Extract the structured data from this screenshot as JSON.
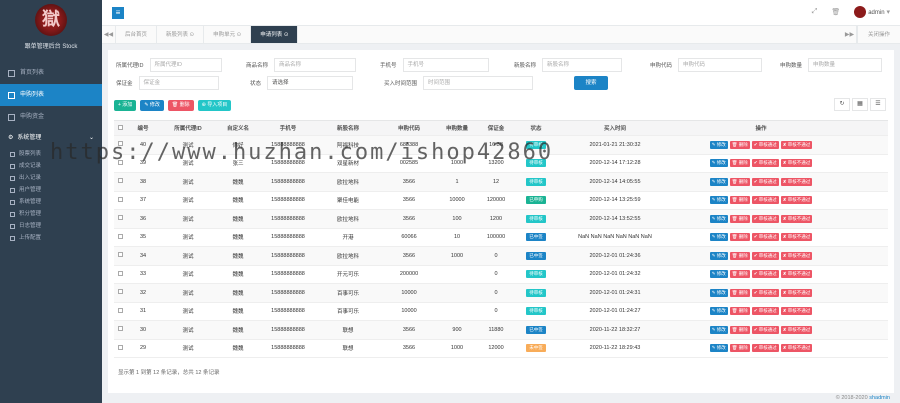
{
  "brand": {
    "title": "跟单管理后台 Stock",
    "badge": "獄"
  },
  "sidebar": {
    "items": [
      {
        "label": "首页列表"
      },
      {
        "label": "申购列表"
      },
      {
        "label": "申购资金"
      }
    ],
    "group": {
      "label": "系统管理",
      "caret": "⌄"
    },
    "sub": [
      {
        "label": "股票列表"
      },
      {
        "label": "成交记录"
      },
      {
        "label": "出入记录"
      },
      {
        "label": "用户管理"
      },
      {
        "label": "系统管理"
      },
      {
        "label": "积分管理"
      },
      {
        "label": "日志管理"
      },
      {
        "label": "上传配置"
      }
    ]
  },
  "topbar": {
    "menu_icon": "≡",
    "admin": "admin",
    "caret": "▾"
  },
  "tabs": {
    "prev": "◀◀",
    "items": [
      {
        "label": "后台首页"
      },
      {
        "label": "新股列表 ⊙"
      },
      {
        "label": "申购单元 ⊙"
      },
      {
        "label": "申请列表 ⊙"
      }
    ],
    "next": "▶▶",
    "close_ops": "关闭操作"
  },
  "filters": {
    "row1": [
      {
        "label": "所属代理ID",
        "placeholder": "所属代理ID"
      },
      {
        "label": "商品名称",
        "placeholder": "商品名称"
      },
      {
        "label": "手机号",
        "placeholder": "手机号"
      },
      {
        "label": "新股名称",
        "placeholder": "新股名称"
      },
      {
        "label": "申购代码",
        "placeholder": "申购代码"
      },
      {
        "label": "申购数量",
        "placeholder": "申购数量"
      }
    ],
    "row2": [
      {
        "label": "保证金",
        "placeholder": "保证金"
      },
      {
        "label": "状态",
        "placeholder": "请选择"
      },
      {
        "label": "买入时间范围",
        "placeholder": "时间范围"
      }
    ],
    "search": "搜索"
  },
  "toolbar": {
    "add": "+ 添加",
    "edit": "✎ 修改",
    "del": "🗑 删除",
    "export": "⊕ 导入项目"
  },
  "table": {
    "headers": [
      "",
      "编号",
      "所属代理ID",
      "自定义名",
      "手机号",
      "新股名称",
      "申购代码",
      "申购数量",
      "保证金",
      "状态",
      "买入时间",
      "操作"
    ],
    "rows": [
      [
        "",
        "40",
        "测试",
        "你好",
        "15888888888",
        "阿福科技",
        "688388",
        "",
        "16.38",
        "待审核",
        "2021-01-21 21:30:32"
      ],
      [
        "",
        "39",
        "测试",
        "张三",
        "15888888888",
        "双星新材",
        "002585",
        "1000",
        "13200",
        "待审核",
        "2020-12-14 17:12:28"
      ],
      [
        "",
        "38",
        "测试",
        "魏魏",
        "15888888888",
        "欧拉地科",
        "3566",
        "1",
        "12",
        "待审核",
        "2020-12-14 14:05:55"
      ],
      [
        "",
        "37",
        "测试",
        "魏魏",
        "15888888888",
        "聚佳电能",
        "3566",
        "10000",
        "120000",
        "已申购",
        "2020-12-14 13:25:59"
      ],
      [
        "",
        "36",
        "测试",
        "魏魏",
        "15888888888",
        "欧拉地科",
        "3566",
        "100",
        "1200",
        "待审核",
        "2020-12-14 13:52:55"
      ],
      [
        "",
        "35",
        "测试",
        "魏魏",
        "15888888888",
        "开港",
        "60066",
        "10",
        "100000",
        "已中签",
        "NaN NaN NaN NaN NaN NaN"
      ],
      [
        "",
        "34",
        "测试",
        "魏魏",
        "15888888888",
        "欧拉地科",
        "3566",
        "1000",
        "0",
        "已中签",
        "2020-12-01 01:24:36"
      ],
      [
        "",
        "33",
        "测试",
        "魏魏",
        "15888888888",
        "开元可乐",
        "200000",
        "",
        "0",
        "待审核",
        "2020-12-01 01:24:32"
      ],
      [
        "",
        "32",
        "测试",
        "魏魏",
        "15888888888",
        "百事可乐",
        "10000",
        "",
        "0",
        "待审核",
        "2020-12-01 01:24:31"
      ],
      [
        "",
        "31",
        "测试",
        "魏魏",
        "15888888888",
        "百事可乐",
        "10000",
        "",
        "0",
        "待审核",
        "2020-12-01 01:24:27"
      ],
      [
        "",
        "30",
        "测试",
        "魏魏",
        "15888888888",
        "联想",
        "3566",
        "900",
        "11880",
        "已中签",
        "2020-11-22 18:32:27"
      ],
      [
        "",
        "29",
        "测试",
        "魏魏",
        "15888888888",
        "联想",
        "3566",
        "1000",
        "12000",
        "未中签",
        "2020-11-22 18:29:43"
      ]
    ],
    "status_colors": {
      "待审核": "#23c6c8",
      "已申购": "#1ab394",
      "已中签": "#1c84c6",
      "未中签": "#f8ac59"
    },
    "ops": {
      "edit": "✎ 修改",
      "del": "🗑 删除",
      "pass": "✔ 审核通过",
      "reject": "✘ 审核不通过"
    }
  },
  "pager": "显示第 1 到第 12 条记录，总共 12 条记录",
  "footer": {
    "text": "© 2018-2020 ",
    "link": "shadmin"
  },
  "watermark": "https://www.huzhan.com/ishop42860"
}
